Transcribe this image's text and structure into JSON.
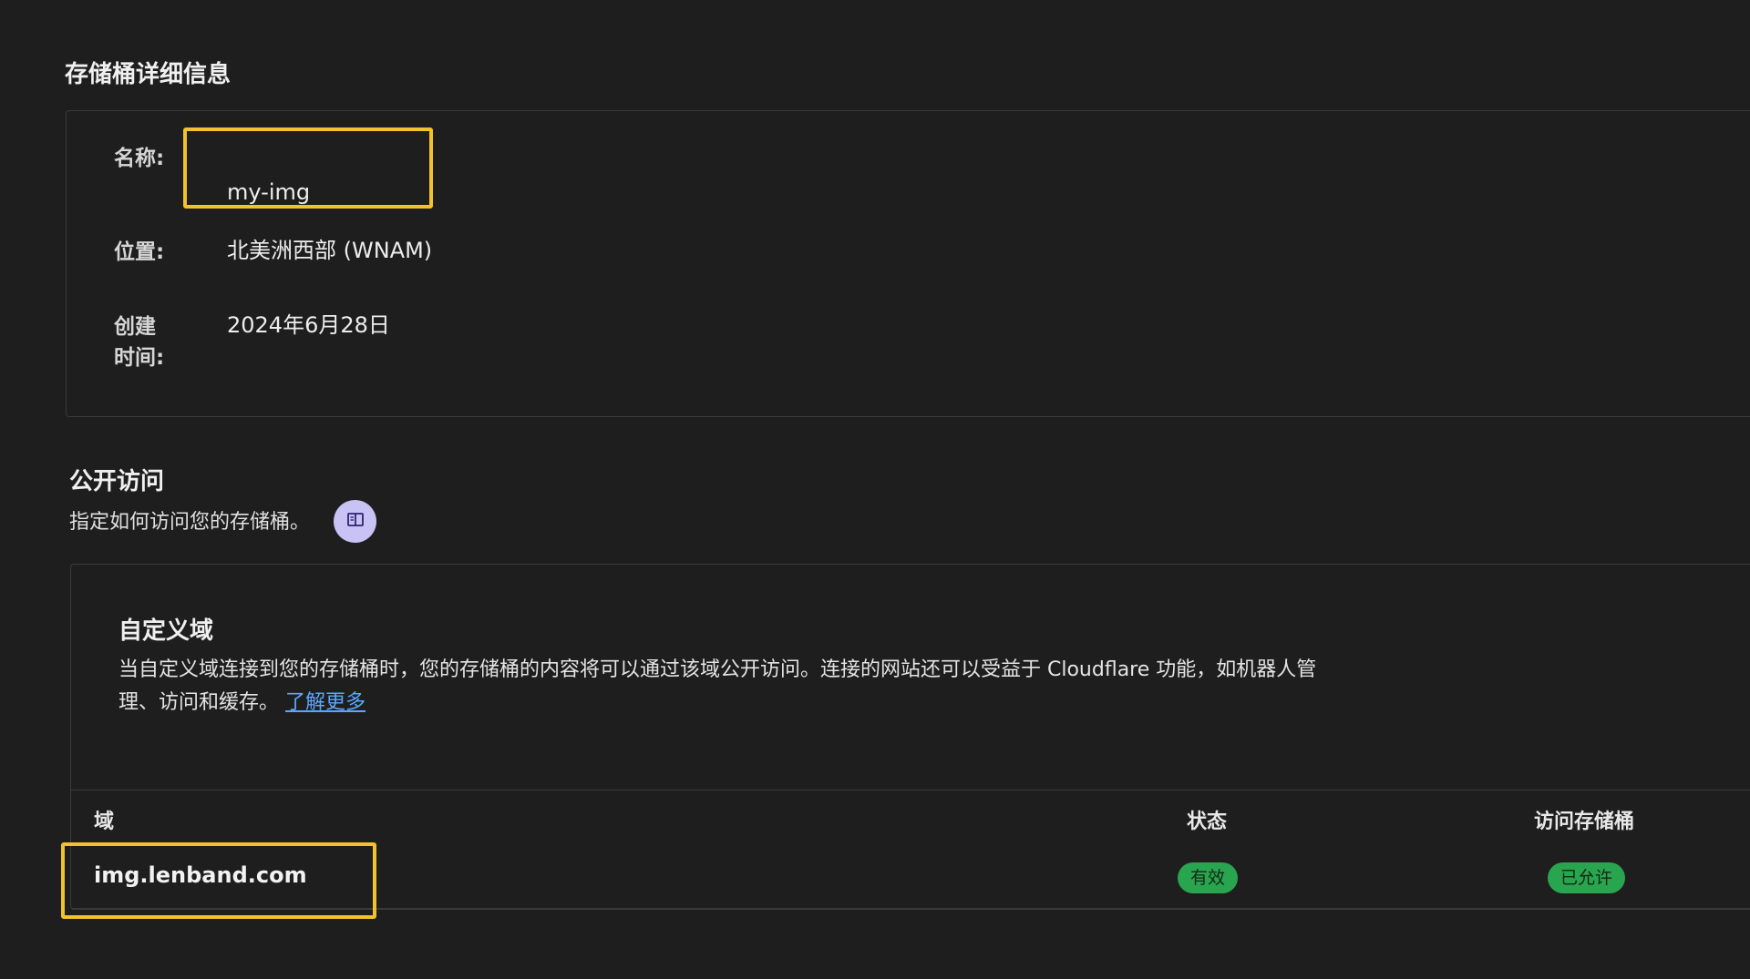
{
  "bucket_details": {
    "title": "存储桶详细信息",
    "name_label": "名称:",
    "name_value": "my-img",
    "location_label": "位置:",
    "location_value": "北美洲西部 (WNAM)",
    "created_label": "创建时间:",
    "created_value": "2024年6月28日"
  },
  "public_access": {
    "title": "公开访问",
    "description": "指定如何访问您的存储桶。",
    "doc_icon": "book-icon"
  },
  "custom_domain": {
    "title": "自定义域",
    "description": "当自定义域连接到您的存储桶时，您的存储桶的内容将可以通过该域公开访问。连接的网站还可以受益于 Cloudflare 功能，如机器人管理、访问和缓存。",
    "learn_more": "了解更多",
    "columns": [
      "域",
      "状态",
      "访问存储桶"
    ],
    "rows": [
      {
        "domain": "img.lenband.com",
        "status": "有效",
        "access": "已允许"
      }
    ]
  },
  "colors": {
    "background": "#1e1e1e",
    "highlight": "#f2c12e",
    "badge_green": "#2aa54f",
    "link": "#5aa7ff",
    "doc_button": "#c9c3f5"
  }
}
